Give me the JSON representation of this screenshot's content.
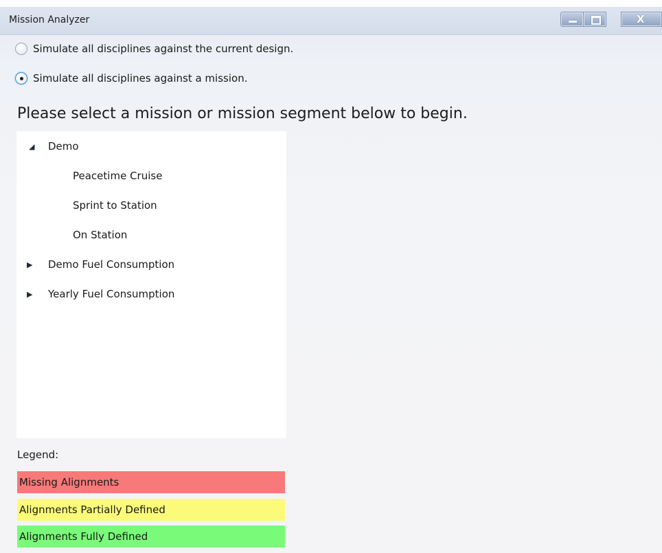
{
  "window": {
    "title": "Mission Analyzer",
    "controls": [
      "minimize",
      "maximize",
      "close"
    ],
    "close_glyph": "X"
  },
  "options": [
    {
      "label": "Simulate all disciplines against the current design.",
      "selected": false
    },
    {
      "label": "Simulate all disciplines against a mission.",
      "selected": true
    }
  ],
  "prompt": "Please select a mission or mission segment below to begin.",
  "tree": {
    "nodes": [
      {
        "label": "Demo",
        "expanded": true,
        "children": [
          "Peacetime Cruise",
          "Sprint to Station",
          "On Station"
        ]
      },
      {
        "label": "Demo Fuel Consumption",
        "expanded": false
      },
      {
        "label": "Yearly Fuel Consumption",
        "expanded": false
      }
    ]
  },
  "legend": {
    "title": "Legend:",
    "items": [
      {
        "label": "Missing Alignments",
        "color": "#f77979"
      },
      {
        "label": "Alignments Partially Defined",
        "color": "#fbfb79"
      },
      {
        "label": "Alignments Fully Defined",
        "color": "#79fb79"
      }
    ]
  },
  "icons": {
    "expanded": "collapse-triangle-icon",
    "collapsed": "expand-triangle-icon"
  }
}
